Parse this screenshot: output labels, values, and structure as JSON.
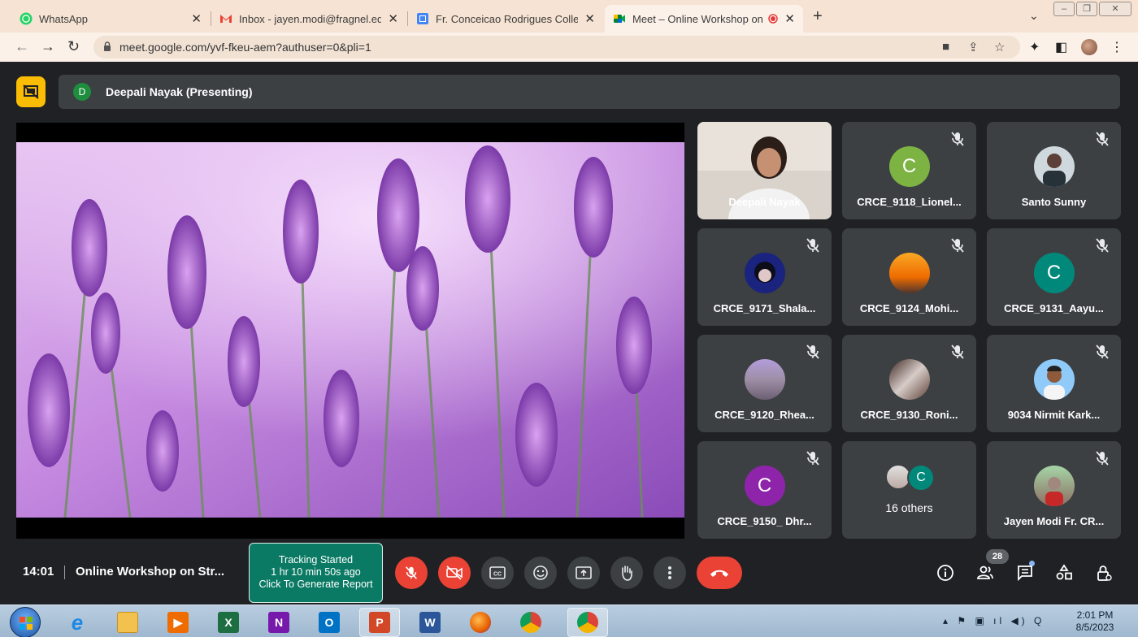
{
  "browser": {
    "tabs": [
      {
        "label": "WhatsApp",
        "active": false
      },
      {
        "label": "Inbox - jayen.modi@fragnel.edu",
        "active": false
      },
      {
        "label": "Fr. Conceicao Rodrigues College",
        "active": false
      },
      {
        "label": "Meet – Online Workshop on",
        "active": true
      }
    ],
    "new_tab": "+",
    "url": "meet.google.com/yvf-fkeu-aem?authuser=0&pli=1"
  },
  "meet": {
    "presenter": {
      "avatar_letter": "D",
      "label": "Deepali Nayak (Presenting)"
    },
    "participants": [
      {
        "name": "Deepali Nayak",
        "type": "video"
      },
      {
        "name": "CRCE_9118_Lionel...",
        "type": "letter",
        "letter": "C",
        "color": "#7cb342"
      },
      {
        "name": "Santo Sunny",
        "type": "photo",
        "color": "#cfd8dc"
      },
      {
        "name": "CRCE_9171_Shala...",
        "type": "photo",
        "color": "#1a237e"
      },
      {
        "name": "CRCE_9124_Mohi...",
        "type": "photo",
        "color": "#f9a825"
      },
      {
        "name": "CRCE_9131_Aayu...",
        "type": "letter",
        "letter": "C",
        "color": "#00897b"
      },
      {
        "name": "CRCE_9120_Rhea...",
        "type": "photo",
        "color": "#9e8fa6"
      },
      {
        "name": "CRCE_9130_Roni...",
        "type": "photo",
        "color": "#5d4037"
      },
      {
        "name": "9034 Nirmit Kark...",
        "type": "photo",
        "color": "#64b5f6"
      },
      {
        "name": "CRCE_9150_ Dhr...",
        "type": "letter",
        "letter": "C",
        "color": "#8e24aa"
      },
      {
        "name": "16 others",
        "type": "others",
        "letter": "C",
        "color": "#00897b"
      },
      {
        "name": "Jayen Modi Fr. CR...",
        "type": "photo",
        "color": "#8d6e63"
      }
    ],
    "time": "14:01",
    "meeting_title": "Online Workshop on Str...",
    "tracking": {
      "line1": "Tracking Started",
      "line2": "1 hr 10 min 50s ago",
      "line3": "Click To Generate Report"
    },
    "people_count": "28"
  },
  "taskbar": {
    "clock_time": "2:01 PM",
    "clock_date": "8/5/2023"
  }
}
